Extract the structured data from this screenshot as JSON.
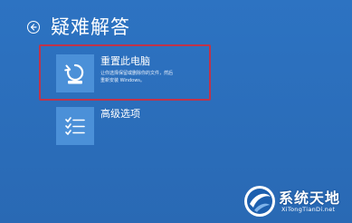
{
  "header": {
    "back_icon": "back-arrow-icon",
    "title": "疑难解答"
  },
  "options": [
    {
      "label": "重置此电脑",
      "icon": "reset-pc-icon",
      "description_lines": [
        "让你选择保留或删除你的文件，然后",
        "重新安装 Windows。"
      ]
    },
    {
      "label": "高级选项",
      "icon": "checklist-icon",
      "description_lines": []
    }
  ],
  "highlight": {
    "color": "#c0334a",
    "target": "重置此电脑"
  },
  "watermark": {
    "title": "系统天地",
    "subtitle": "XiTongTianDi.net",
    "logo_icon": "globe-logo-icon"
  },
  "colors": {
    "background": "#2a6fbe",
    "tile": "#4b90d8",
    "text": "#ffffff"
  }
}
